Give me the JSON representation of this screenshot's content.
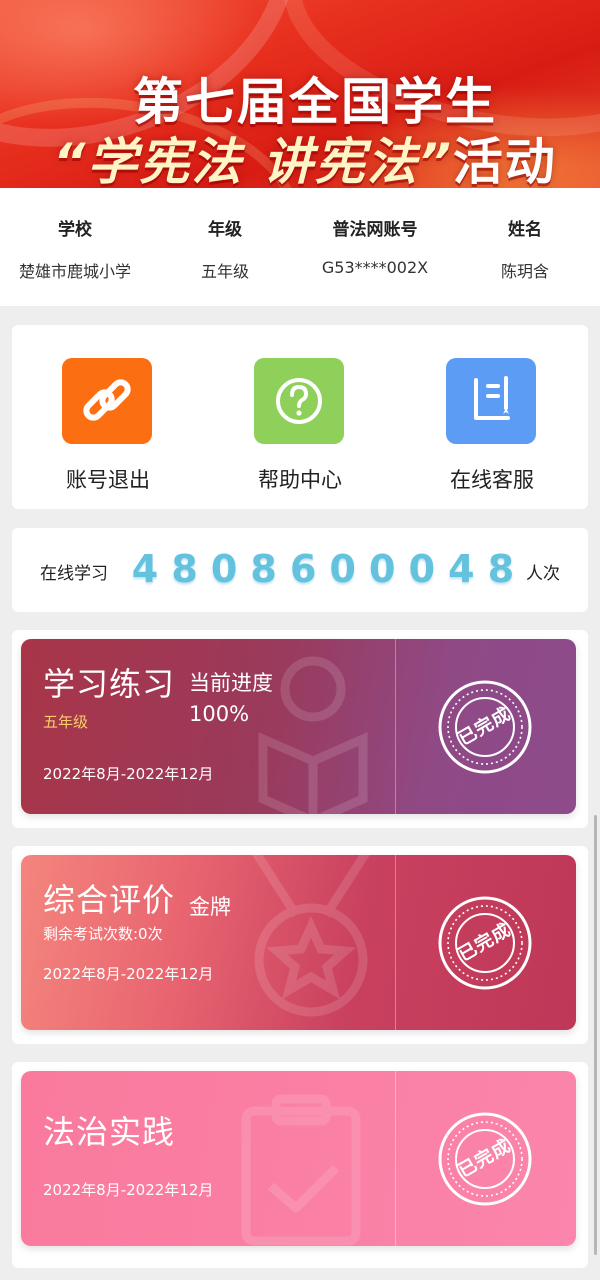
{
  "banner": {
    "title_line1": "第七届全国学生",
    "title_line2_quoted": "“学宪法 讲宪法”",
    "title_line2_tail": "活动"
  },
  "info": {
    "school_label": "学校",
    "school_value": "楚雄市鹿城小学",
    "grade_label": "年级",
    "grade_value": "五年级",
    "account_label": "普法网账号",
    "account_value": "G53****002X",
    "name_label": "姓名",
    "name_value": "陈玥含"
  },
  "actions": [
    {
      "label": "账号退出",
      "icon": "link-icon",
      "color": "#fb6e12"
    },
    {
      "label": "帮助中心",
      "icon": "help-icon",
      "color": "#8ed05a"
    },
    {
      "label": "在线客服",
      "icon": "service-icon",
      "color": "#5c9cf5"
    }
  ],
  "counter": {
    "prefix": "在线学习",
    "digits": [
      "4",
      "8",
      "0",
      "8",
      "6",
      "0",
      "0",
      "0",
      "4",
      "8"
    ],
    "suffix": "人次"
  },
  "cards": [
    {
      "title": "学习练习",
      "subtitle": "五年级",
      "side_line1": "当前进度",
      "side_line2": "100%",
      "date": "2022年8月-2022年12月",
      "stamp": "已完成"
    },
    {
      "title": "综合评价",
      "subtitle": "剩余考试次数:0次",
      "side_line1": "金牌",
      "date": "2022年8月-2022年12月",
      "stamp": "已完成"
    },
    {
      "title": "法治实践",
      "date": "2022年8月-2022年12月",
      "stamp": "已完成"
    }
  ],
  "colors": {
    "accent_red": "#e8301e",
    "digit_cyan": "#63c2dd",
    "card1": "#9a3a5c",
    "card2": "#c9415f",
    "card3": "#fa7fa4"
  }
}
